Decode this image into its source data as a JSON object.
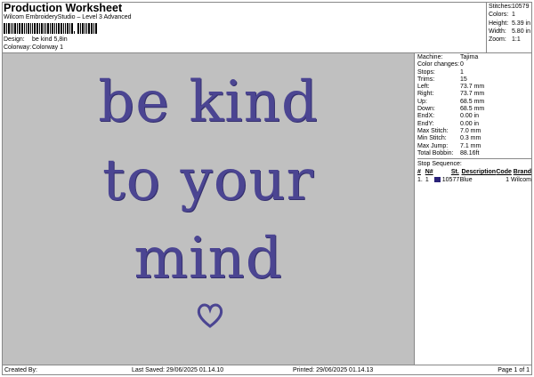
{
  "header": {
    "title": "Production Worksheet",
    "subtitle": "Wilcom EmbroideryStudio – Level 3 Advanced",
    "design_label": "Design:",
    "design_value": "be kind 5,8in",
    "colorway_label": "Colorway:",
    "colorway_value": "Colorway 1"
  },
  "summary": [
    {
      "k": "Stitches:",
      "v": "10579"
    },
    {
      "k": "Colors:",
      "v": "1"
    },
    {
      "k": "Height:",
      "v": "5.39 in"
    },
    {
      "k": "Width:",
      "v": "5.80 in"
    },
    {
      "k": "Zoom:",
      "v": "1:1"
    }
  ],
  "design": {
    "lines": [
      "be kind",
      "to your",
      "mind"
    ],
    "heart": "♡",
    "thread_color": "#4b4592",
    "background": "#c0c0c0"
  },
  "details": [
    {
      "k": "Machine:",
      "v": "Tajima"
    },
    {
      "k": "Color changes:",
      "v": "0"
    },
    {
      "k": "Stops:",
      "v": "1"
    },
    {
      "k": "Trims:",
      "v": "15"
    },
    {
      "k": "Left:",
      "v": "73.7 mm"
    },
    {
      "k": "Right:",
      "v": "73.7 mm"
    },
    {
      "k": "Up:",
      "v": "68.5 mm"
    },
    {
      "k": "Down:",
      "v": "68.5 mm"
    },
    {
      "k": "EndX:",
      "v": "0.00 in"
    },
    {
      "k": "EndY:",
      "v": "0.00 in"
    },
    {
      "k": "Max Stitch:",
      "v": "7.0 mm"
    },
    {
      "k": "Min Stitch:",
      "v": "0.3 mm"
    },
    {
      "k": "Max Jump:",
      "v": "7.1 mm"
    },
    {
      "k": "Total Bobbin:",
      "v": "88.16ft"
    }
  ],
  "stop_sequence": {
    "title": "Stop Sequence:",
    "headers": [
      "#",
      "N#",
      "St.",
      "Description",
      "Code",
      "Brand"
    ],
    "rows": [
      {
        "num": "1.",
        "n": "1",
        "color": "#2a2278",
        "st": "10577",
        "description": "Blue",
        "code": "1",
        "brand": "Wilcom"
      }
    ]
  },
  "footer": {
    "created_by": "Created By:",
    "last_saved": "Last Saved: 29/06/2025 01.14.10",
    "printed": "Printed: 29/06/2025 01.14.13",
    "page": "Page 1 of 1"
  }
}
